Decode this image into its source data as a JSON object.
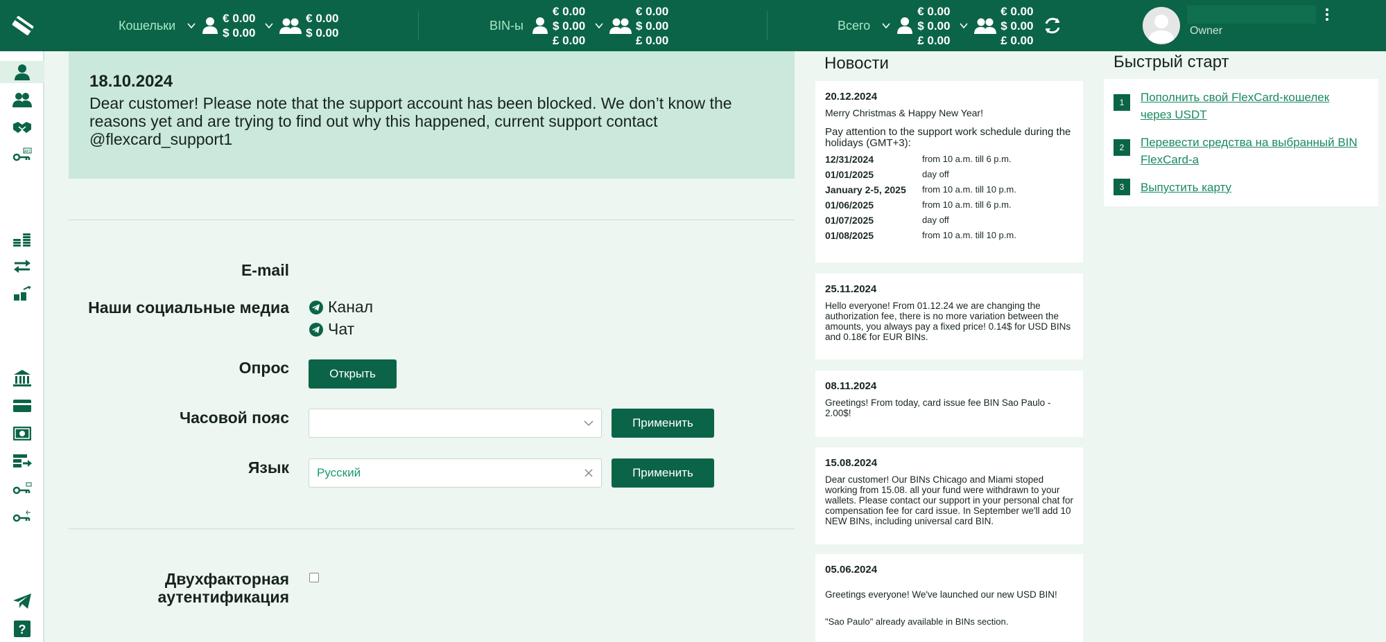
{
  "header": {
    "wallets_label": "Кошельки",
    "bins_label": "BIN-ы",
    "total_label": "Всего",
    "wallets_personal": [
      "€ 0.00",
      "$ 0.00"
    ],
    "wallets_team": [
      "€ 0.00",
      "$ 0.00"
    ],
    "bins_personal": [
      "€ 0.00",
      "$ 0.00",
      "£ 0.00"
    ],
    "bins_team": [
      "€ 0.00",
      "$ 0.00",
      "£ 0.00"
    ],
    "total_personal": [
      "€ 0.00",
      "$ 0.00",
      "£ 0.00"
    ],
    "total_team": [
      "€ 0.00",
      "$ 0.00",
      "£ 0.00"
    ],
    "role": "Owner"
  },
  "alert": {
    "date": "18.10.2024",
    "text": "Dear customer! Please note that the support account has been blocked. We don’t know the reasons yet and are trying to find out why this happened, current support contact @flexcard_support1"
  },
  "form": {
    "email_label": "E-mail",
    "social_label": "Наши социальные медиа",
    "channel": "Канал",
    "chat": "Чат",
    "poll_label": "Опрос",
    "poll_button": "Открыть",
    "timezone_label": "Часовой пояс",
    "timezone_value": "",
    "apply": "Применить",
    "language_label": "Язык",
    "language_value": "Русский",
    "twofa_label_1": "Двухфакторная",
    "twofa_label_2": "аутентификация"
  },
  "news": {
    "title": "Новости",
    "items": [
      {
        "date": "20.12.2024",
        "greeting": "Merry Christmas & Happy New Year!",
        "intro": "Pay attention to the support work schedule during the holidays (GMT+3):",
        "schedule": [
          {
            "day": "12/31/2024",
            "hours": "from 10 a.m. till 6 p.m."
          },
          {
            "day": "01/01/2025",
            "hours": "day off"
          },
          {
            "day": "January 2-5, 2025",
            "hours": "from 10 a.m. till 10 p.m."
          },
          {
            "day": "01/06/2025",
            "hours": "from 10 a.m. till 6 p.m."
          },
          {
            "day": "01/07/2025",
            "hours": "day off"
          },
          {
            "day": "01/08/2025",
            "hours": "from 10 a.m. till 10 p.m."
          }
        ]
      },
      {
        "date": "25.11.2024",
        "text": "Hello everyone! From 01.12.24 we are changing the authorization fee, there is no more variation between the amounts, you always pay a fixed price! 0.14$ for USD BINs and 0.18€ for EUR BINs."
      },
      {
        "date": "08.11.2024",
        "text": "Greetings! From today, card issue fee BIN Sao Paulo - 2.00$!"
      },
      {
        "date": "15.08.2024",
        "text": "Dear customer! Our BINs Chicago and Miami stoped working from 15.08. all your fund were withdrawn to your wallets. Please contact our support in your personal chat for compensation fee for card issue. In September we'll add 10 NEW BINs, including universal card BIN."
      },
      {
        "date": "05.06.2024",
        "text": "Greetings everyone! We've launched our new USD BIN!",
        "note": "\"Sao Paulo\" already available in BINs section."
      }
    ]
  },
  "quickstart": {
    "title": "Быстрый старт",
    "items": [
      {
        "num": "1",
        "label": "Пополнить свой FlexCard-кошелек через USDT"
      },
      {
        "num": "2",
        "label": "Перевести средства на выбранный BIN FlexCard-а"
      },
      {
        "num": "3",
        "label": "Выпустить карту"
      }
    ]
  },
  "colors": {
    "brand": "#0b6447",
    "link": "#1a8a5e",
    "alert_bg": "#cbe8dc",
    "page_bg": "#edf6f1"
  }
}
